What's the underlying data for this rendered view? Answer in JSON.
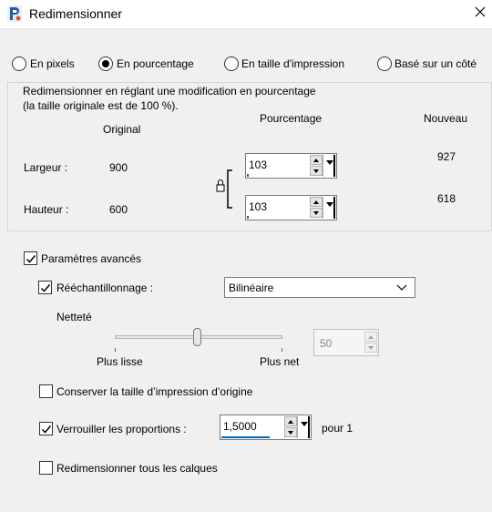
{
  "window": {
    "title": "Redimensionner"
  },
  "mode_options": [
    {
      "label": "En pixels",
      "checked": false
    },
    {
      "label": "En pourcentage",
      "checked": true
    },
    {
      "label": "En taille d'impression",
      "checked": false
    },
    {
      "label": "Basé sur un côté",
      "checked": false
    }
  ],
  "group": {
    "description_line1": "Redimensionner en réglant une modification en pourcentage",
    "description_line2": "(la taille originale est de 100 %).",
    "col_original": "Original",
    "col_percentage": "Pourcentage",
    "col_new": "Nouveau",
    "width": {
      "label": "Largeur :",
      "original": "900",
      "percent": "103",
      "new": "927"
    },
    "height": {
      "label": "Hauteur :",
      "original": "600",
      "percent": "103",
      "new": "618"
    }
  },
  "advanced": {
    "label": "Paramètres avancés",
    "checked": true,
    "resample": {
      "label": "Rééchantillonnage :",
      "checked": true,
      "method": "Bilinéaire"
    },
    "sharpness": {
      "label": "Netteté",
      "min_label": "Plus lisse",
      "max_label": "Plus net",
      "value": "50",
      "level_fraction": 0.5
    },
    "keep_print_size": {
      "label": "Conserver la taille d’impression d’origine",
      "checked": false
    },
    "lock_ratio": {
      "label": "Verrouiller les proportions :",
      "checked": true,
      "value": "1,5000",
      "suffix": "pour 1"
    },
    "resize_all_layers": {
      "label": "Redimensionner tous les calques",
      "checked": false
    }
  }
}
